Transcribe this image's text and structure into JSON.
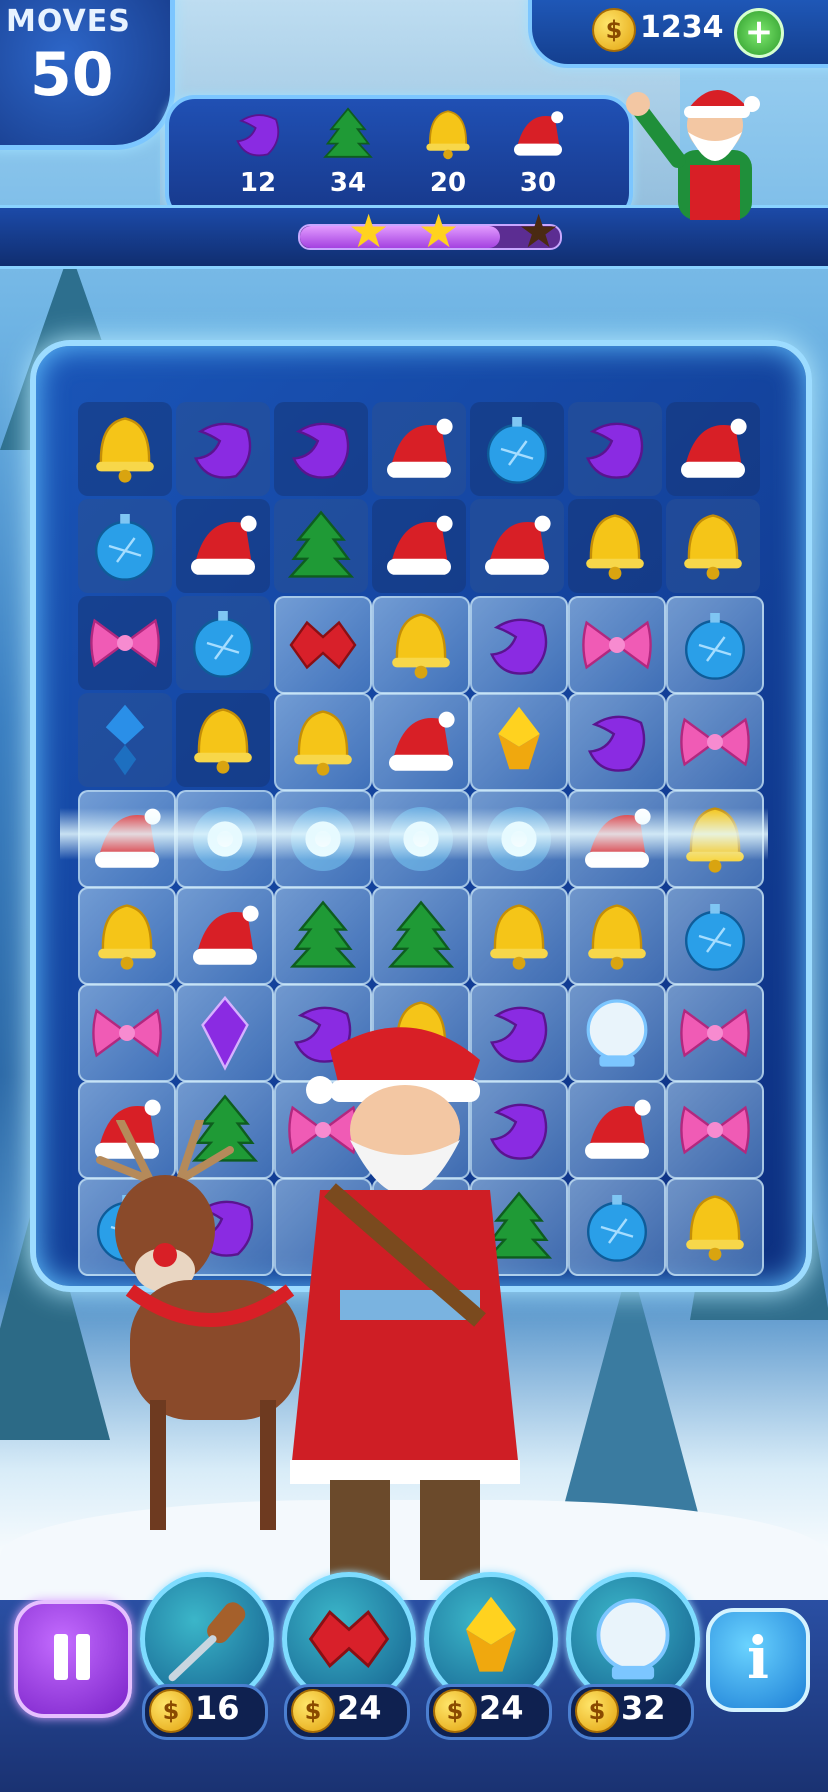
{
  "hud": {
    "moves_label": "MOVES",
    "moves_value": "50",
    "coins": "1234",
    "coin_symbol": "$",
    "plus": "+"
  },
  "goals": [
    {
      "icon": "purple-moon-gem-icon",
      "count": "12"
    },
    {
      "icon": "green-tree-gem-icon",
      "count": "34"
    },
    {
      "icon": "yellow-bell-gem-icon",
      "count": "20"
    },
    {
      "icon": "santa-hat-gem-icon",
      "count": "30"
    }
  ],
  "progress": {
    "fill_fraction": 0.78,
    "stars_earned": 2,
    "stars_total": 3
  },
  "board": {
    "cols": 7,
    "rows": 9,
    "pieces": [
      [
        "bell",
        "moon",
        "moon",
        "hat",
        "ornament",
        "moon",
        "hat"
      ],
      [
        "ornament",
        "hat",
        "tree",
        "hat",
        "hat",
        "bell",
        "bell"
      ],
      [
        "bow",
        "ornament",
        "redcrystal",
        "bell",
        "moon",
        "bow",
        "ornament"
      ],
      [
        "bluecrystal",
        "bell",
        "bell",
        "hat",
        "yellowcrystal",
        "moon",
        "bow"
      ],
      [
        "hat",
        "blast",
        "blast",
        "blast",
        "blast",
        "hat",
        "bell"
      ],
      [
        "bell",
        "hat",
        "tree",
        "tree",
        "bell",
        "bell",
        "ornament"
      ],
      [
        "bow",
        "purplecrystal",
        "moon",
        "bell",
        "moon",
        "snowglobe",
        "bow"
      ],
      [
        "hat",
        "tree",
        "bow",
        "",
        "moon",
        "hat",
        "bow"
      ],
      [
        "ornament",
        "moon",
        "",
        "",
        "tree",
        "ornament",
        "bell"
      ]
    ],
    "ice_rows": [
      2,
      3,
      4,
      5,
      6,
      7,
      8
    ],
    "ice_start_col": [
      2,
      2,
      0,
      0,
      0,
      0,
      0
    ]
  },
  "boosters": [
    {
      "icon": "screwdriver-booster-icon",
      "price": "16"
    },
    {
      "icon": "red-crystal-booster-icon",
      "price": "24"
    },
    {
      "icon": "yellow-crystal-booster-icon",
      "price": "24"
    },
    {
      "icon": "snow-globe-booster-icon",
      "price": "32"
    }
  ],
  "buttons": {
    "info": "i"
  },
  "colors": {
    "hat": "#d81f26",
    "bell": "#f5c518",
    "moon": "#8a2be2",
    "ornament": "#2a9fe8",
    "tree": "#1f9a36",
    "bow": "#f05bb5",
    "accent_ice": "#7cc6ff"
  }
}
